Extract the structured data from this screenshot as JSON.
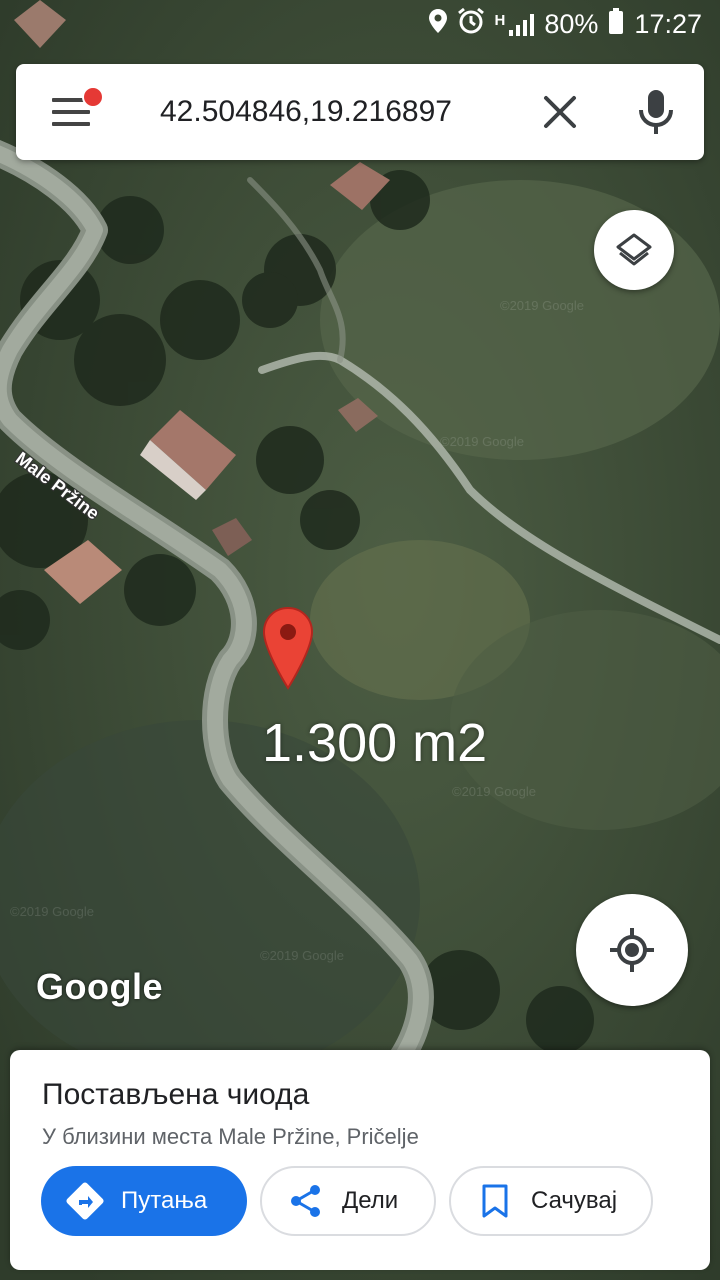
{
  "status_bar": {
    "battery_percent": "80%",
    "time": "17:27",
    "network_type": "H",
    "icons": [
      "location-icon",
      "alarm-icon",
      "signal-icon",
      "battery-icon"
    ]
  },
  "search": {
    "value": "42.504846,19.216897",
    "has_notification": true
  },
  "map": {
    "road_label": "Male Pržine",
    "annotation": "1.300 m2",
    "logo": "Google",
    "layer_type": "satellite",
    "pin_color": "#ea4335"
  },
  "place": {
    "title": "Постављена чиода",
    "subtitle": "У близини места Male Pržine, Pričelje"
  },
  "actions": {
    "directions_label": "Путања",
    "share_label": "Дели",
    "save_label": "Сачувај"
  },
  "colors": {
    "primary": "#1a73e8",
    "pin": "#ea4335",
    "notification": "#e53935"
  }
}
